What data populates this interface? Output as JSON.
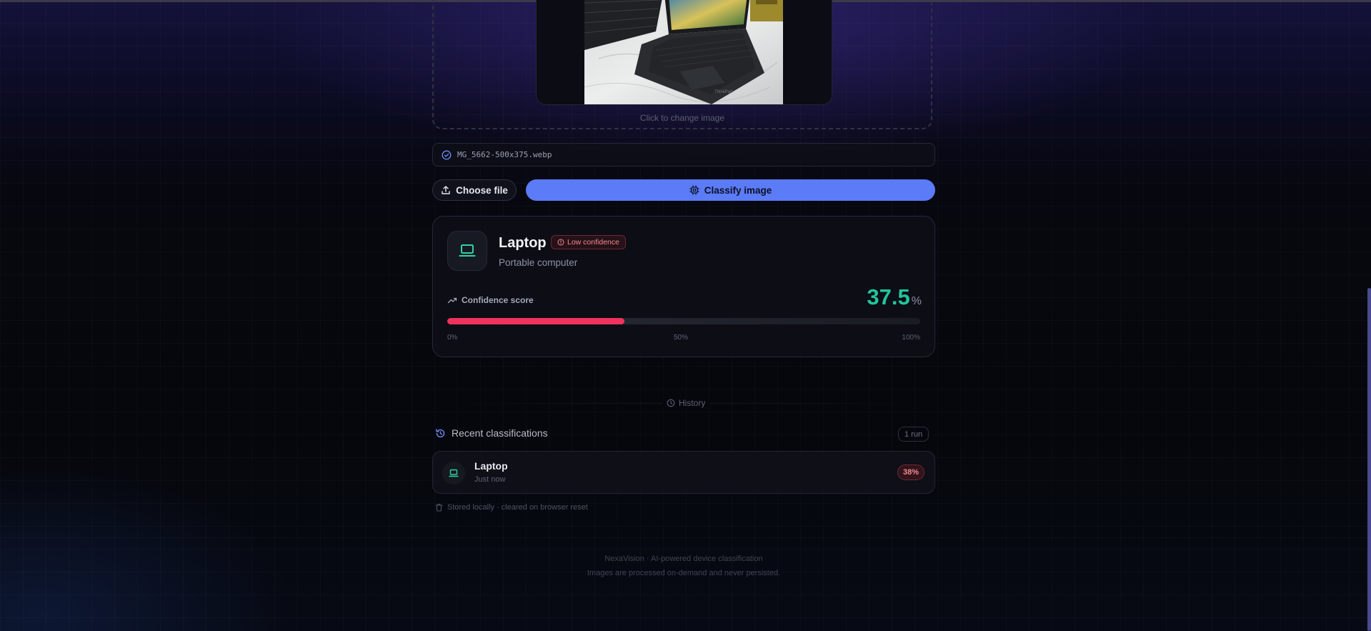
{
  "dropzone": {
    "hint": "Click to change image"
  },
  "file": {
    "name": "MG_5662-500x375.webp"
  },
  "actions": {
    "choose_label": "Choose file",
    "classify_label": "Classify image"
  },
  "result": {
    "label": "Laptop",
    "badge": "Low confidence",
    "subtitle": "Portable computer",
    "confidence_label": "Confidence score",
    "confidence_value": "37.5",
    "confidence_unit": "%",
    "confidence_fraction": 0.375,
    "scale": {
      "min": "0%",
      "mid": "50%",
      "max": "100%"
    }
  },
  "history": {
    "section_label": "History",
    "title": "Recent classifications",
    "runs_badge": "1 run",
    "items": [
      {
        "label": "Laptop",
        "time": "Just now",
        "percent": "38%"
      }
    ],
    "storage_note": "Stored locally · cleared on browser reset"
  },
  "footer": {
    "line1": "NexaVision · AI-powered device classification",
    "line2": "Images are processed on-demand and never persisted."
  },
  "colors": {
    "accent": "#5b7bf7",
    "confidence_text": "#22c59a",
    "bar_fill": "#f0325d",
    "warning": "#f08a8a"
  },
  "icons": {
    "file_status": "check-circle-icon",
    "choose": "upload-icon",
    "classify": "cpu-icon",
    "result": "laptop-icon",
    "confidence": "trending-up-icon",
    "history": "clock-icon",
    "recent": "history-icon",
    "storage": "trash-icon"
  }
}
